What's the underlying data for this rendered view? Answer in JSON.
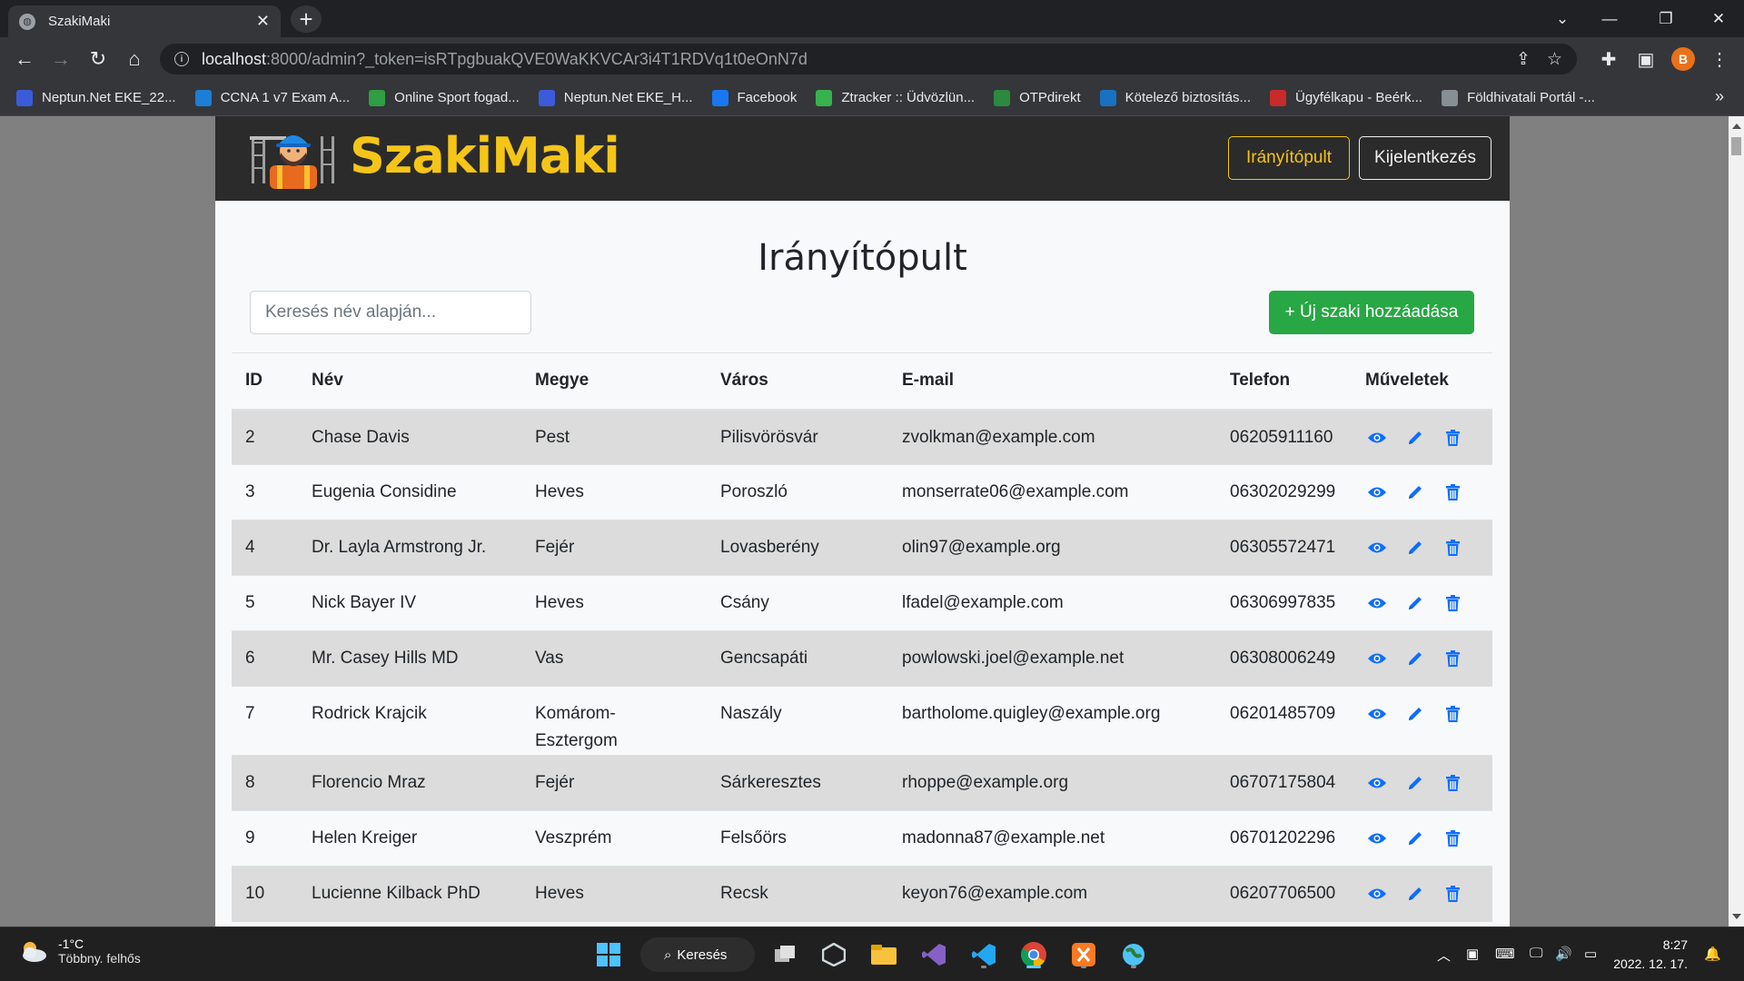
{
  "browser": {
    "tab_title": "SzakiMaki",
    "url_host": "localhost",
    "url_rest": ":8000/admin?_token=isRTpgbuakQVE0WaKKVCAr3i4T1RDVq1t0eOnN7d",
    "profile_initial": "B",
    "bookmarks": [
      {
        "label": "Neptun.Net EKE_22...",
        "color": "#3b5bdb"
      },
      {
        "label": "CCNA 1 v7 Exam A...",
        "color": "#1c7ed6"
      },
      {
        "label": "Online Sport fogad...",
        "color": "#2f9e44"
      },
      {
        "label": "Neptun.Net EKE_H...",
        "color": "#3b5bdb"
      },
      {
        "label": "Facebook",
        "color": "#1877f2"
      },
      {
        "label": "Ztracker :: Üdvözlün...",
        "color": "#37b24d"
      },
      {
        "label": "OTPdirekt",
        "color": "#2b8a3e"
      },
      {
        "label": "Kötelező biztosítás...",
        "color": "#1971c2"
      },
      {
        "label": "Ügyfélkapu - Beérk...",
        "color": "#c92a2a"
      },
      {
        "label": "Földhivatali Portál -...",
        "color": "#868e96"
      }
    ]
  },
  "site": {
    "brand": "SzakiMaki",
    "nav_dashboard": "Irányítópult",
    "nav_logout": "Kijelentkezés",
    "colors": {
      "accent": "#f5c518",
      "header_bg": "#2b2b2b",
      "success": "#28a745",
      "action": "#0d6efd"
    }
  },
  "main": {
    "title": "Irányítópult",
    "search_placeholder": "Keresés név alapján...",
    "add_button": "+ Új szaki hozzáadása",
    "columns": {
      "id": "ID",
      "name": "Név",
      "county": "Megye",
      "city": "Város",
      "email": "E-mail",
      "phone": "Telefon",
      "actions": "Műveletek"
    },
    "rows": [
      {
        "id": "2",
        "name": "Chase Davis",
        "county": "Pest",
        "city": "Pilisvörösvár",
        "email": "zvolkman@example.com",
        "phone": "06205911160"
      },
      {
        "id": "3",
        "name": "Eugenia Considine",
        "county": "Heves",
        "city": "Poroszló",
        "email": "monserrate06@example.com",
        "phone": "06302029299"
      },
      {
        "id": "4",
        "name": "Dr. Layla Armstrong Jr.",
        "county": "Fejér",
        "city": "Lovasberény",
        "email": "olin97@example.org",
        "phone": "06305572471"
      },
      {
        "id": "5",
        "name": "Nick Bayer IV",
        "county": "Heves",
        "city": "Csány",
        "email": "lfadel@example.com",
        "phone": "06306997835"
      },
      {
        "id": "6",
        "name": "Mr. Casey Hills MD",
        "county": "Vas",
        "city": "Gencsapáti",
        "email": "powlowski.joel@example.net",
        "phone": "06308006249"
      },
      {
        "id": "7",
        "name": "Rodrick Krajcik",
        "county": "Komárom-Esztergom",
        "city": "Naszály",
        "email": "bartholome.quigley@example.org",
        "phone": "06201485709"
      },
      {
        "id": "8",
        "name": "Florencio Mraz",
        "county": "Fejér",
        "city": "Sárkeresztes",
        "email": "rhoppe@example.org",
        "phone": "06707175804"
      },
      {
        "id": "9",
        "name": "Helen Kreiger",
        "county": "Veszprém",
        "city": "Felsőörs",
        "email": "madonna87@example.net",
        "phone": "06701202296"
      },
      {
        "id": "10",
        "name": "Lucienne Kilback PhD",
        "county": "Heves",
        "city": "Recsk",
        "email": "keyon76@example.com",
        "phone": "06207706500"
      }
    ]
  },
  "taskbar": {
    "temperature": "-1°C",
    "weather_desc": "Többny. felhős",
    "search_label": "Keresés",
    "time": "8:27",
    "date": "2022. 12. 17."
  }
}
